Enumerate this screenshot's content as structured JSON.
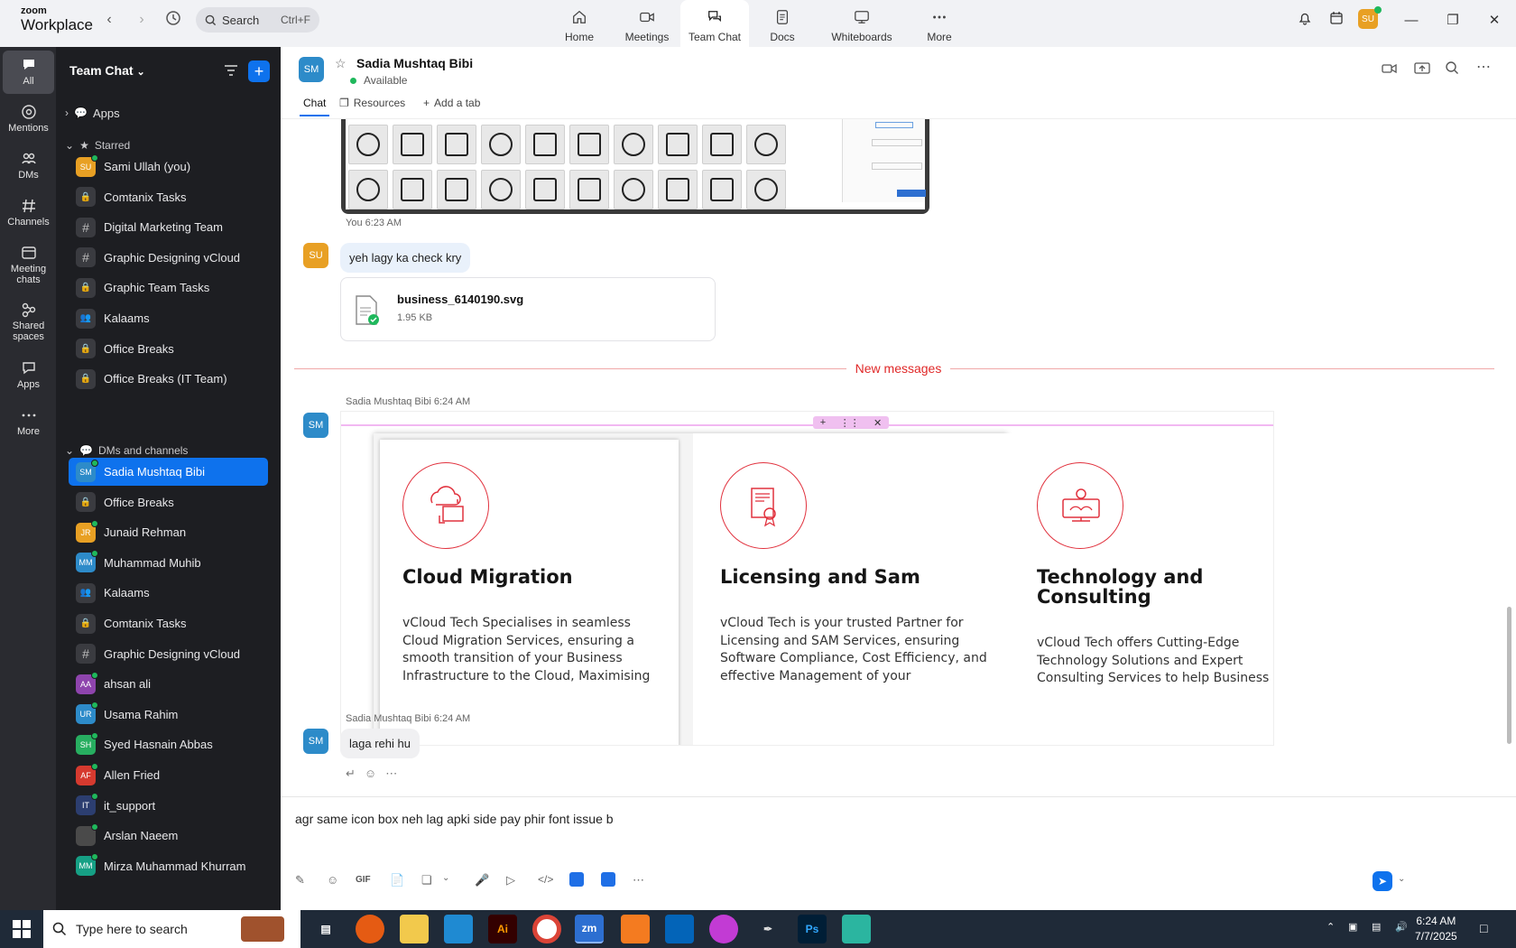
{
  "app": {
    "logo_top": "zoom",
    "logo_bottom": "Workplace"
  },
  "search": {
    "label": "Search",
    "shortcut": "Ctrl+F"
  },
  "tabs": [
    {
      "label": "Home",
      "icon": "home-icon"
    },
    {
      "label": "Meetings",
      "icon": "video-icon"
    },
    {
      "label": "Team Chat",
      "icon": "chat-icon"
    },
    {
      "label": "Docs",
      "icon": "doc-icon"
    },
    {
      "label": "Whiteboards",
      "icon": "whiteboard-icon"
    },
    {
      "label": "More",
      "icon": "more-icon"
    }
  ],
  "topbar": {
    "avatar": "SU"
  },
  "rail": [
    {
      "label": "All"
    },
    {
      "label": "Mentions"
    },
    {
      "label": "DMs"
    },
    {
      "label": "Channels"
    },
    {
      "label": "Meeting chats"
    },
    {
      "label": "Shared spaces"
    },
    {
      "label": "Apps"
    },
    {
      "label": "More"
    }
  ],
  "sidebar": {
    "title": "Team Chat",
    "apps_label": "Apps",
    "starred_label": "Starred",
    "dms_label": "DMs and channels",
    "starred": [
      {
        "name": "Sami Ullah (you)",
        "initials": "SU",
        "color": "#e8a024",
        "kind": "avatar"
      },
      {
        "name": "Comtanix Tasks",
        "kind": "lock"
      },
      {
        "name": "Digital Marketing Team",
        "kind": "hash"
      },
      {
        "name": "Graphic Designing vCloud",
        "kind": "hash"
      },
      {
        "name": "Graphic Team Tasks",
        "kind": "lock"
      },
      {
        "name": "Kalaams",
        "kind": "group"
      },
      {
        "name": "Office Breaks",
        "kind": "lock"
      },
      {
        "name": "Office Breaks (IT Team)",
        "kind": "lock"
      }
    ],
    "dms": [
      {
        "name": "Sadia Mushtaq Bibi",
        "initials": "SM",
        "color": "#2d8bc9",
        "kind": "avatar"
      },
      {
        "name": "Office Breaks",
        "kind": "lock"
      },
      {
        "name": "Junaid Rehman",
        "initials": "JR",
        "color": "#e8a024",
        "kind": "avatar"
      },
      {
        "name": "Muhammad Muhib",
        "initials": "MM",
        "color": "#2d8bc9",
        "kind": "avatar"
      },
      {
        "name": "Kalaams",
        "kind": "group"
      },
      {
        "name": "Comtanix Tasks",
        "kind": "lock"
      },
      {
        "name": "Graphic Designing vCloud",
        "kind": "hash"
      },
      {
        "name": "ahsan ali",
        "initials": "AA",
        "color": "#8e44ad",
        "kind": "avatar"
      },
      {
        "name": "Usama Rahim",
        "initials": "UR",
        "color": "#2d8bc9",
        "kind": "avatar"
      },
      {
        "name": "Syed Hasnain Abbas",
        "initials": "SH",
        "color": "#27ae60",
        "kind": "avatar"
      },
      {
        "name": "Allen Fried",
        "initials": "AF",
        "color": "#d63a2f",
        "kind": "avatar"
      },
      {
        "name": "it_support",
        "initials": "IT",
        "color": "#2c3e70",
        "kind": "avatar"
      },
      {
        "name": "Arslan Naeem",
        "initials": "",
        "color": "#4a4a4a",
        "kind": "avatar"
      },
      {
        "name": "Mirza Muhammad Khurram",
        "initials": "MM",
        "color": "#16a085",
        "kind": "avatar"
      }
    ]
  },
  "chat": {
    "name": "Sadia Mushtaq Bibi",
    "initials": "SM",
    "status": "Available",
    "tabs": [
      "Chat",
      "Resources",
      "Add a tab"
    ],
    "msg1_meta": "You 6:23 AM",
    "msg1_initials": "SU",
    "msg1_text": "yeh lagy ka check kry",
    "file_name": "business_6140190.svg",
    "file_size": "1.95 KB",
    "new_messages": "New messages",
    "msg2_meta": "Sadia Mushtaq Bibi 6:24 AM",
    "msg3_meta": "Sadia Mushtaq Bibi 6:24 AM",
    "msg3_text": "laga rehi hu",
    "composer_text": "agr same icon box neh lag apki side pay phir font issue b"
  },
  "cards": [
    {
      "title": "Cloud Migration",
      "body": "vCloud Tech Specialises in seamless Cloud Migration Services, ensuring a smooth transition of your Business Infrastructure to the Cloud, Maximising"
    },
    {
      "title": "Licensing and Sam",
      "body": "vCloud Tech is your trusted Partner for Licensing and SAM Services, ensuring Software Compliance, Cost Efficiency, and effective Management of your"
    },
    {
      "title": "Technology and Consulting",
      "body": "vCloud Tech offers Cutting-Edge Technology Solutions and Expert Consulting Services to help Business"
    }
  ],
  "toolbar": {
    "gif": "GIF"
  },
  "taskbar": {
    "search": "Type here to search",
    "time": "6:24 AM",
    "date": "7/7/2025",
    "ai": "Ai",
    "zm": "zm",
    "ps": "Ps"
  },
  "colors": {
    "accent": "#0e72ed",
    "new_messages": "#e02828",
    "card_circle": "#e1323e"
  }
}
